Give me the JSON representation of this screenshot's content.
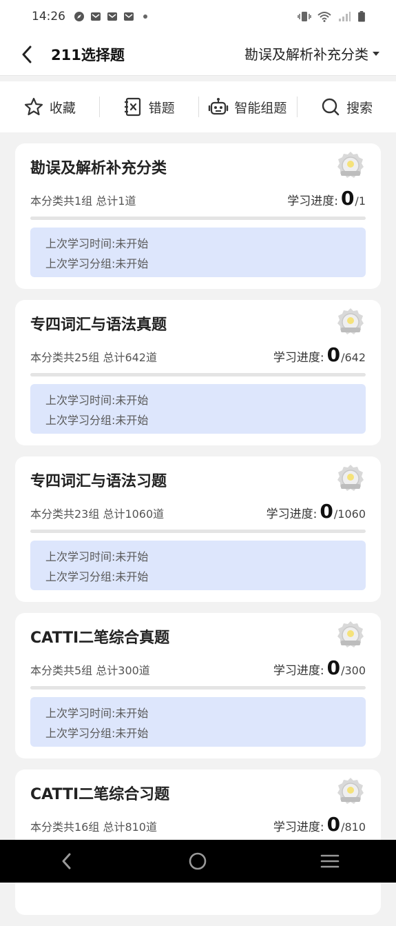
{
  "status_bar": {
    "time": "14:26"
  },
  "header": {
    "title": "211选择题",
    "category_label": "勘误及解析补充分类"
  },
  "toolbar": [
    {
      "label": "收藏",
      "icon": "star-icon"
    },
    {
      "label": "错题",
      "icon": "wrong-question-icon"
    },
    {
      "label": "智能组题",
      "icon": "robot-icon"
    },
    {
      "label": "搜索",
      "icon": "search-icon"
    }
  ],
  "cards": [
    {
      "title": "勘误及解析补充分类",
      "meta": "本分类共1组 总计1道",
      "progress_label": "学习进度:",
      "done": "0",
      "total": "/1",
      "progress_fraction": 0,
      "last_time": "上次学习时间:未开始",
      "last_group": "上次学习分组:未开始",
      "badge_icon": "medal-badge-icon"
    },
    {
      "title": "专四词汇与语法真题",
      "meta": "本分类共25组 总计642道",
      "progress_label": "学习进度:",
      "done": "0",
      "total": "/642",
      "progress_fraction": 0,
      "last_time": "上次学习时间:未开始",
      "last_group": "上次学习分组:未开始",
      "badge_icon": "medal-badge-icon"
    },
    {
      "title": "专四词汇与语法习题",
      "meta": "本分类共23组 总计1060道",
      "progress_label": "学习进度:",
      "done": "0",
      "total": "/1060",
      "progress_fraction": 0,
      "last_time": "上次学习时间:未开始",
      "last_group": "上次学习分组:未开始",
      "badge_icon": "medal-badge-icon"
    },
    {
      "title": "CATTI二笔综合真题",
      "meta": "本分类共5组 总计300道",
      "progress_label": "学习进度:",
      "done": "0",
      "total": "/300",
      "progress_fraction": 0,
      "last_time": "上次学习时间:未开始",
      "last_group": "上次学习分组:未开始",
      "badge_icon": "medal-badge-icon"
    },
    {
      "title": "CATTI二笔综合习题",
      "meta": "本分类共16组 总计810道",
      "progress_label": "学习进度:",
      "done": "0",
      "total": "/810",
      "progress_fraction": 0,
      "last_time": "",
      "last_group": "",
      "badge_icon": "medal-badge-icon"
    }
  ],
  "colors": {
    "accent": "#4a7df0",
    "info_bg": "#dde6fc",
    "page_bg": "#f2f2f2"
  }
}
